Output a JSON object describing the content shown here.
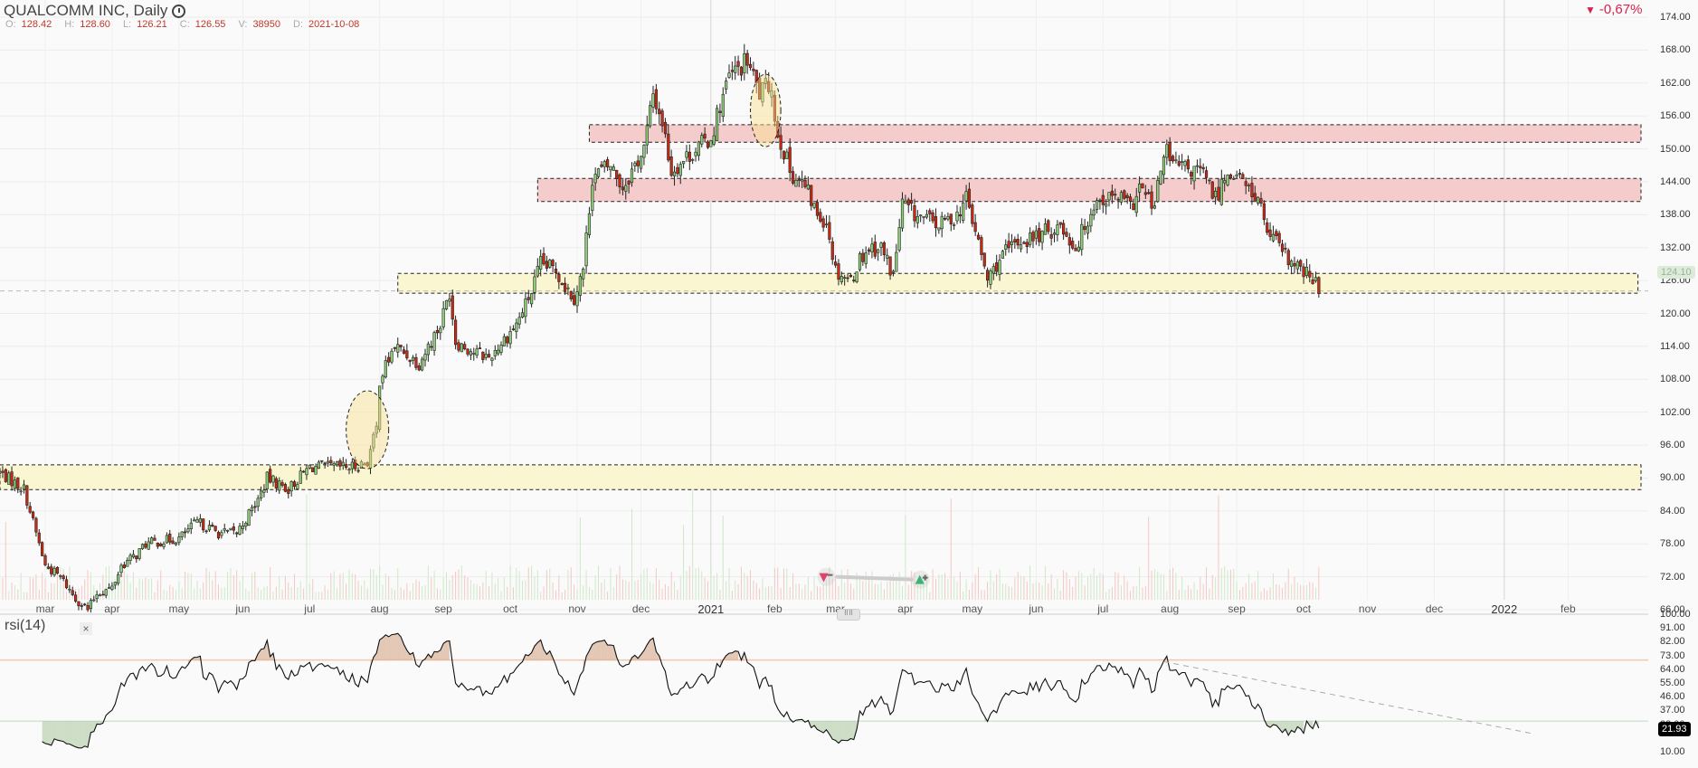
{
  "header": {
    "title": "QUALCOMM INC, Daily",
    "clock_icon": "clock-icon"
  },
  "ohlc": [
    {
      "k": "O:",
      "v": "128.42"
    },
    {
      "k": "H:",
      "v": "128.60"
    },
    {
      "k": "L:",
      "v": "126.21"
    },
    {
      "k": "C:",
      "v": "126.55"
    },
    {
      "k": "V:",
      "v": "38950"
    },
    {
      "k": "D:",
      "v": "2021-10-08"
    }
  ],
  "change": {
    "arrow": "▼",
    "value": "-0,67%",
    "color": "#d9214d"
  },
  "last_price_label": "124.10",
  "rsi": {
    "name": "rsi(14)",
    "close": "×",
    "current": "21.93"
  },
  "colors": {
    "up": "#8fd07a",
    "down": "#cc2a12",
    "zone_red": "#f4cccc",
    "zone_yellow": "#fbf6d2",
    "overbought": "#f0c8b0",
    "oversold": "#d5e3d5"
  },
  "chart_data": {
    "type": "candlestick",
    "title": "QUALCOMM INC, Daily",
    "price_axis": {
      "ticks": [
        "174.00",
        "168.00",
        "162.00",
        "156.00",
        "150.00",
        "144.00",
        "138.00",
        "132.00",
        "126.00",
        "120.00",
        "114.00",
        "108.00",
        "102.00",
        "96.00",
        "90.00",
        "84.00",
        "78.00",
        "72.00",
        "66.00"
      ],
      "ylim": [
        66,
        174
      ]
    },
    "x_axis": [
      {
        "date": "2020-03-02",
        "label": "mar"
      },
      {
        "date": "2020-04-01",
        "label": "apr"
      },
      {
        "date": "2020-05-01",
        "label": "may"
      },
      {
        "date": "2020-06-01",
        "label": "jun"
      },
      {
        "date": "2020-07-01",
        "label": "jul"
      },
      {
        "date": "2020-08-03",
        "label": "aug"
      },
      {
        "date": "2020-09-01",
        "label": "sep"
      },
      {
        "date": "2020-10-01",
        "label": "oct"
      },
      {
        "date": "2020-11-02",
        "label": "nov"
      },
      {
        "date": "2020-12-01",
        "label": "dec"
      },
      {
        "date": "2021-01-01",
        "label": "2021",
        "year": true
      },
      {
        "date": "2021-02-01",
        "label": "feb"
      },
      {
        "date": "2021-03-01",
        "label": "mar"
      },
      {
        "date": "2021-04-01",
        "label": "apr"
      },
      {
        "date": "2021-05-03",
        "label": "may"
      },
      {
        "date": "2021-06-01",
        "label": "jun"
      },
      {
        "date": "2021-07-01",
        "label": "jul"
      },
      {
        "date": "2021-08-02",
        "label": "aug"
      },
      {
        "date": "2021-09-01",
        "label": "sep"
      },
      {
        "date": "2021-10-01",
        "label": "oct"
      },
      {
        "date": "2021-11-01",
        "label": "nov"
      },
      {
        "date": "2021-12-01",
        "label": "dec"
      },
      {
        "date": "2022-01-03",
        "label": "2022",
        "year": true
      },
      {
        "date": "2022-02-01",
        "label": "feb"
      }
    ],
    "close_keypoints": [
      [
        "2020-02-10",
        91
      ],
      [
        "2020-02-20",
        88
      ],
      [
        "2020-02-26",
        80
      ],
      [
        "2020-03-02",
        74
      ],
      [
        "2020-03-09",
        72
      ],
      [
        "2020-03-16",
        68
      ],
      [
        "2020-03-20",
        66
      ],
      [
        "2020-03-25",
        69
      ],
      [
        "2020-04-01",
        70
      ],
      [
        "2020-04-06",
        74
      ],
      [
        "2020-04-11",
        76
      ],
      [
        "2020-04-16",
        78
      ],
      [
        "2020-05-01",
        79
      ],
      [
        "2020-05-10",
        82
      ],
      [
        "2020-05-20",
        80
      ],
      [
        "2020-05-28",
        80
      ],
      [
        "2020-06-06",
        86
      ],
      [
        "2020-06-11",
        90
      ],
      [
        "2020-06-21",
        88
      ],
      [
        "2020-07-01",
        92
      ],
      [
        "2020-07-11",
        92
      ],
      [
        "2020-07-21",
        92
      ],
      [
        "2020-07-28",
        93
      ],
      [
        "2020-07-31",
        99
      ],
      [
        "2020-08-03",
        108
      ],
      [
        "2020-08-10",
        114
      ],
      [
        "2020-08-20",
        111
      ],
      [
        "2020-08-30",
        118
      ],
      [
        "2020-09-03",
        124
      ],
      [
        "2020-09-07",
        115
      ],
      [
        "2020-09-15",
        113
      ],
      [
        "2020-09-22",
        112
      ],
      [
        "2020-09-30",
        116
      ],
      [
        "2020-10-05",
        118
      ],
      [
        "2020-10-10",
        124
      ],
      [
        "2020-10-15",
        129
      ],
      [
        "2020-10-22",
        128
      ],
      [
        "2020-10-27",
        125
      ],
      [
        "2020-10-30",
        123
      ],
      [
        "2020-11-04",
        128
      ],
      [
        "2020-11-07",
        145
      ],
      [
        "2020-11-12",
        146
      ],
      [
        "2020-11-17",
        147
      ],
      [
        "2020-11-22",
        143
      ],
      [
        "2020-11-27",
        147
      ],
      [
        "2020-12-02",
        150
      ],
      [
        "2020-12-07",
        160
      ],
      [
        "2020-12-10",
        155
      ],
      [
        "2020-12-15",
        146
      ],
      [
        "2020-12-20",
        148
      ],
      [
        "2020-12-25",
        150
      ],
      [
        "2021-01-01",
        152
      ],
      [
        "2021-01-06",
        158
      ],
      [
        "2021-01-11",
        163
      ],
      [
        "2021-01-19",
        166
      ],
      [
        "2021-01-24",
        160
      ],
      [
        "2021-01-29",
        162
      ],
      [
        "2021-02-01",
        155
      ],
      [
        "2021-02-06",
        146
      ],
      [
        "2021-02-14",
        143
      ],
      [
        "2021-02-19",
        138
      ],
      [
        "2021-02-24",
        137
      ],
      [
        "2021-03-01",
        128
      ],
      [
        "2021-03-06",
        126
      ],
      [
        "2021-03-11",
        130
      ],
      [
        "2021-03-16",
        132
      ],
      [
        "2021-03-21",
        132
      ],
      [
        "2021-03-26",
        127
      ],
      [
        "2021-03-31",
        140
      ],
      [
        "2021-04-06",
        138
      ],
      [
        "2021-04-16",
        136
      ],
      [
        "2021-04-26",
        138
      ],
      [
        "2021-04-29",
        141
      ],
      [
        "2021-05-04",
        135
      ],
      [
        "2021-05-09",
        126
      ],
      [
        "2021-05-14",
        130
      ],
      [
        "2021-05-22",
        133
      ],
      [
        "2021-06-01",
        134
      ],
      [
        "2021-06-11",
        136
      ],
      [
        "2021-06-18",
        132
      ],
      [
        "2021-06-26",
        140
      ],
      [
        "2021-07-01",
        141
      ],
      [
        "2021-07-09",
        141
      ],
      [
        "2021-07-14",
        139
      ],
      [
        "2021-07-19",
        143
      ],
      [
        "2021-07-24",
        139
      ],
      [
        "2021-07-29",
        150
      ],
      [
        "2021-08-03",
        147
      ],
      [
        "2021-08-11",
        146
      ],
      [
        "2021-08-16",
        146
      ],
      [
        "2021-08-21",
        141
      ],
      [
        "2021-08-26",
        145
      ],
      [
        "2021-08-31",
        146
      ],
      [
        "2021-09-05",
        143
      ],
      [
        "2021-09-10",
        141
      ],
      [
        "2021-09-15",
        135
      ],
      [
        "2021-09-22",
        131
      ],
      [
        "2021-09-27",
        129
      ],
      [
        "2021-10-02",
        127
      ],
      [
        "2021-10-08",
        125
      ]
    ],
    "last_price": 124.1,
    "zones": [
      {
        "name": "resistance-zone-upper",
        "color": "red",
        "from": "2020-11-06",
        "to": "2022-03-07",
        "low": 151.2,
        "high": 154.4
      },
      {
        "name": "resistance-zone-lower",
        "color": "red",
        "from": "2020-10-14",
        "to": "2022-03-07",
        "low": 140.4,
        "high": 144.6
      },
      {
        "name": "support-zone-upper",
        "color": "yellow",
        "from": "2020-08-11",
        "to": "2022-03-04",
        "low": 123.7,
        "high": 127.3
      },
      {
        "name": "support-zone-lower",
        "color": "yellow",
        "from": "2020-02-01",
        "to": "2022-03-07",
        "low": 87.9,
        "high": 92.4
      }
    ],
    "ellipses": [
      {
        "name": "breakout-ellipse",
        "date": "2020-07-28",
        "price": 98.8,
        "price_radius": 7.1,
        "day_radius": 7
      },
      {
        "name": "top-ellipse",
        "date": "2021-01-27",
        "price": 157,
        "price_radius": 6.6,
        "day_radius": 5
      }
    ],
    "markers": [
      {
        "type": "sell",
        "date": "2021-02-24",
        "price": 72,
        "color": "#e0446a"
      },
      {
        "type": "buy",
        "date": "2021-04-08",
        "price": 71.5,
        "color": "#3cb371"
      }
    ],
    "rsi_panel": {
      "period": 14,
      "ticks": [
        "100.00",
        "91.00",
        "82.00",
        "73.00",
        "64.00",
        "55.00",
        "46.00",
        "37.00",
        "28.00",
        "10.00"
      ],
      "ylim": [
        10,
        100
      ],
      "overbought": 70,
      "oversold": 30,
      "trendline": [
        [
          "2021-07-29",
          69
        ],
        [
          "2022-01-14",
          22
        ]
      ]
    }
  }
}
